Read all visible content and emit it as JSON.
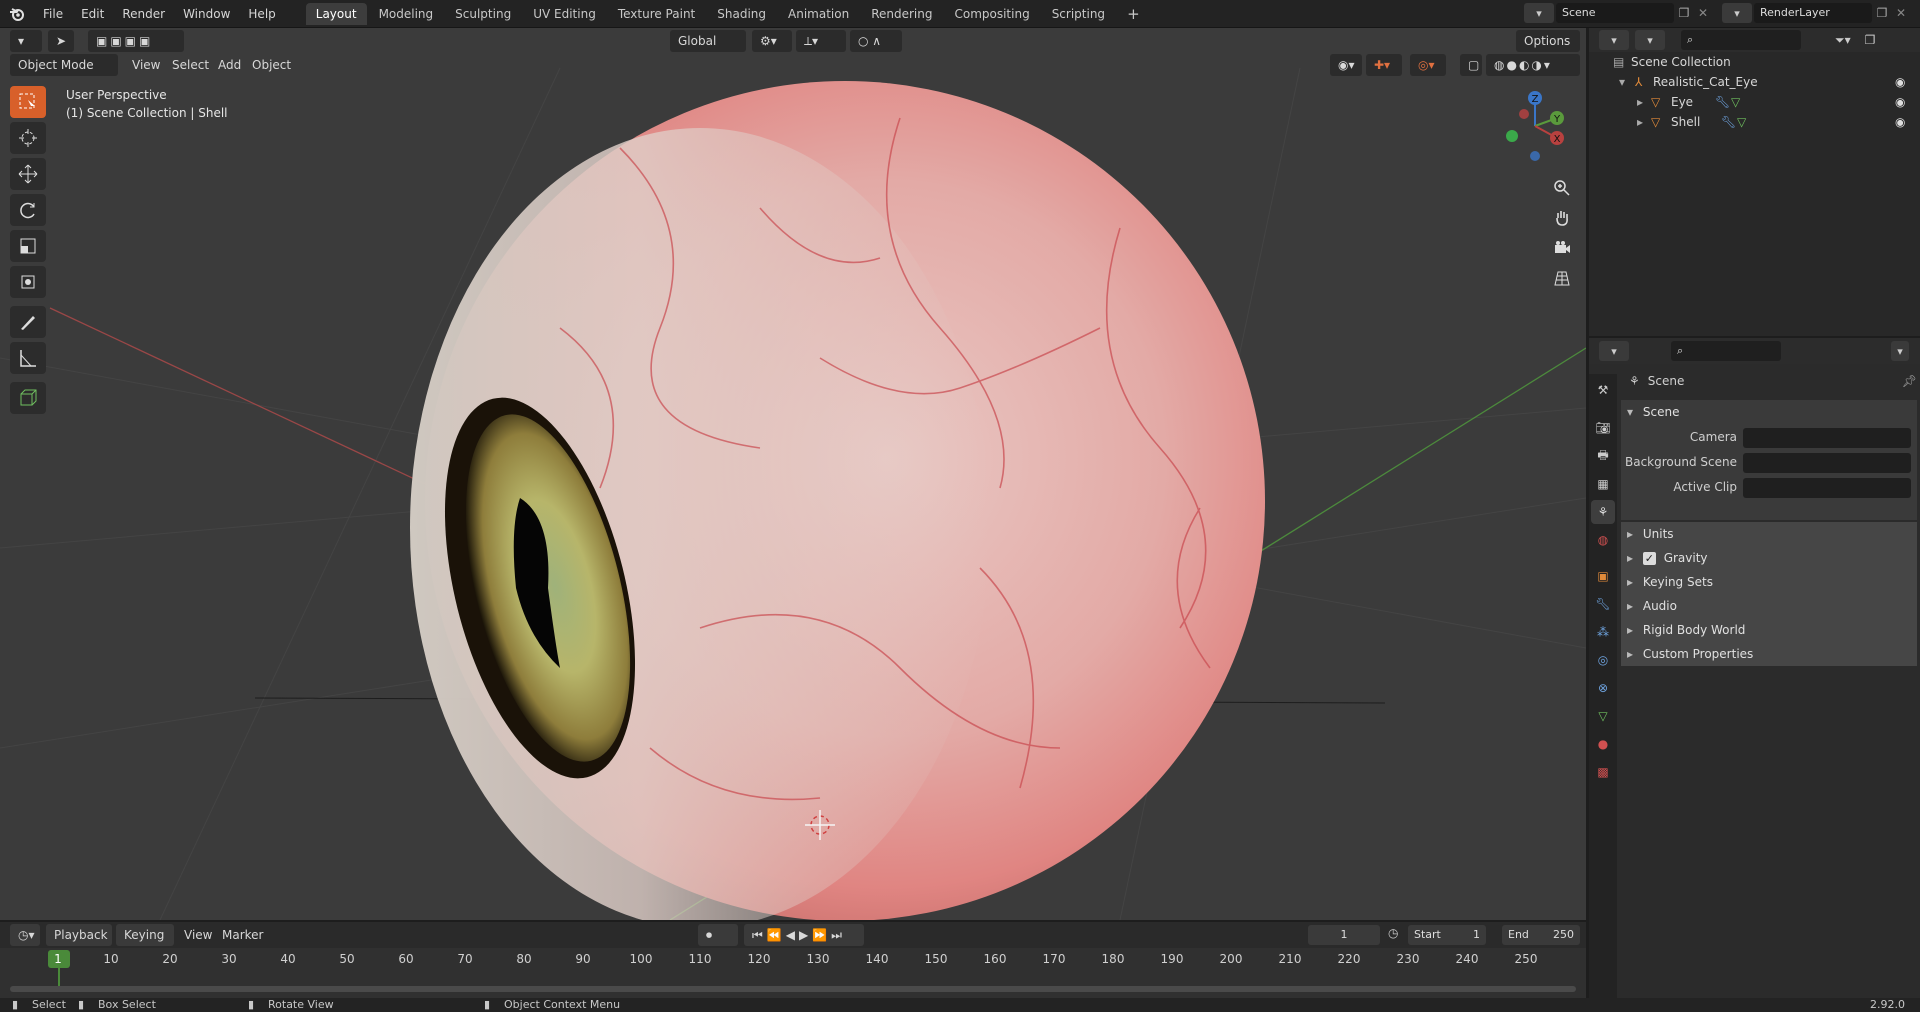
{
  "menu": [
    "File",
    "Edit",
    "Render",
    "Window",
    "Help"
  ],
  "workspaces": {
    "tabs": [
      "Layout",
      "Modeling",
      "Sculpting",
      "UV Editing",
      "Texture Paint",
      "Shading",
      "Animation",
      "Rendering",
      "Compositing",
      "Scripting"
    ],
    "active": "Layout",
    "add_symbol": "+"
  },
  "scene_selector": {
    "value": "Scene"
  },
  "view_layer_selector": {
    "value": "RenderLayer"
  },
  "viewport": {
    "mode": "Object Mode",
    "menus": [
      "View",
      "Select",
      "Add",
      "Object"
    ],
    "transform_orientation": "Global",
    "options_label": "Options",
    "info_line1": "User Perspective",
    "info_line2": "(1) Scene Collection | Shell",
    "gizmo_axes": {
      "z": "Z",
      "y": "Y",
      "x": "X"
    },
    "colors": {
      "x_axis": "#b8413f",
      "y_axis": "#5a9a3c",
      "z_axis": "#3a76c8",
      "active_tool": "#d8602a"
    }
  },
  "outliner": {
    "root": "Scene Collection",
    "collection": "Realistic_Cat_Eye",
    "objects": [
      "Eye",
      "Shell"
    ]
  },
  "properties": {
    "header": "Scene",
    "panel_title": "Scene",
    "fields": [
      {
        "label": "Camera"
      },
      {
        "label": "Background Scene"
      },
      {
        "label": "Active Clip"
      }
    ],
    "subpanels": [
      "Units",
      "Gravity",
      "Keying Sets",
      "Audio",
      "Rigid Body World",
      "Custom Properties"
    ],
    "gravity_checked": true
  },
  "timeline": {
    "menus": [
      "Playback",
      "Keying",
      "View",
      "Marker"
    ],
    "current_frame": "1",
    "start_label": "Start",
    "start_value": "1",
    "end_label": "End",
    "end_value": "250",
    "ticks": [
      "1",
      "10",
      "20",
      "30",
      "40",
      "50",
      "60",
      "70",
      "80",
      "90",
      "100",
      "110",
      "120",
      "130",
      "140",
      "150",
      "160",
      "170",
      "180",
      "190",
      "200",
      "210",
      "220",
      "230",
      "240",
      "250"
    ]
  },
  "statusbar": {
    "select": "Select",
    "box_select": "Box Select",
    "rotate_view": "Rotate View",
    "context_menu": "Object Context Menu",
    "version": "2.92.0"
  }
}
